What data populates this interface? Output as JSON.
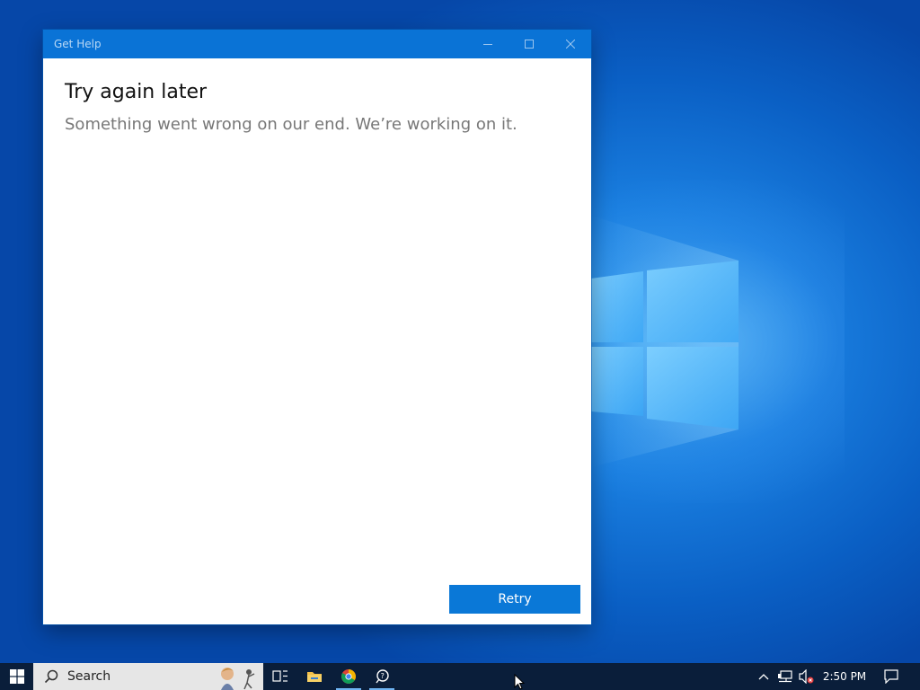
{
  "window": {
    "title": "Get Help",
    "heading": "Try again later",
    "message": "Something went wrong on our end. We’re working on it.",
    "retry_label": "Retry",
    "accent": "#0a78d7"
  },
  "taskbar": {
    "search_placeholder": "Search",
    "clock": "2:50 PM",
    "pinned": [
      "task-view-icon",
      "file-explorer-icon",
      "chrome-icon",
      "get-help-icon"
    ],
    "background": "#0a1e3a"
  }
}
